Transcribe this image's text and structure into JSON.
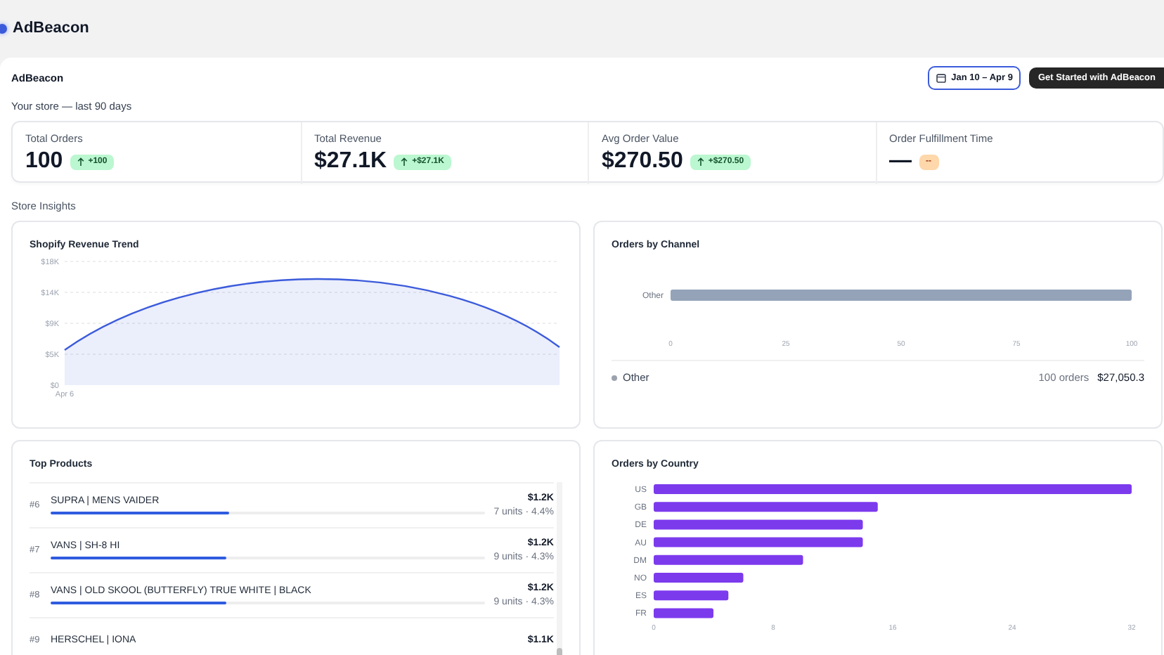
{
  "header": {
    "title": "AdBeacon"
  },
  "page": {
    "title": "AdBeacon",
    "subtitle": "Your store — last 90 days",
    "date_range": "Jan 10 – Apr 9",
    "cta": "Get Started with AdBeacon"
  },
  "kpis": [
    {
      "label": "Total Orders",
      "value": "100",
      "delta": "+100",
      "kind": "up"
    },
    {
      "label": "Total Revenue",
      "value": "$27.1K",
      "delta": "+$27.1K",
      "kind": "up"
    },
    {
      "label": "Avg Order Value",
      "value": "$270.50",
      "delta": "+$270.50",
      "kind": "up"
    },
    {
      "label": "Order Fulfillment Time",
      "value": "—",
      "delta": "--",
      "kind": "flat"
    }
  ],
  "section_title": "Store Insights",
  "revenue_trend": {
    "title": "Shopify Revenue Trend",
    "y_labels": [
      "$18K",
      "$14K",
      "$9K",
      "$5K",
      "$0"
    ],
    "x_labels": [
      "Apr 6"
    ]
  },
  "channels": {
    "title": "Orders by Channel",
    "chart_data": {
      "type": "bar",
      "orientation": "horizontal",
      "categories": [
        "Other"
      ],
      "series": [
        {
          "color": "#94a3b8",
          "values": [
            100
          ]
        }
      ],
      "xlim": [
        0,
        100
      ],
      "xticks": [
        0,
        25,
        50,
        75,
        100
      ]
    },
    "legend": [
      {
        "name": "Other",
        "color": "#9ca3af",
        "orders": "100 orders",
        "revenue": "$27,050.3"
      }
    ]
  },
  "top_products": {
    "title": "Top Products",
    "items": [
      {
        "rank": "#6",
        "name": "SUPRA | MENS VAIDER",
        "level": 0.41,
        "revenue": "$1.2K",
        "detail": "7 units · 4.4%"
      },
      {
        "rank": "#7",
        "name": "VANS | SH-8 HI",
        "level": 0.405,
        "revenue": "$1.2K",
        "detail": "9 units · 4.3%"
      },
      {
        "rank": "#8",
        "name": "VANS | OLD SKOOL (BUTTERFLY) TRUE WHITE | BLACK",
        "level": 0.405,
        "revenue": "$1.2K",
        "detail": "9 units · 4.3%"
      },
      {
        "rank": "#9",
        "name": "HERSCHEL | IONA",
        "revenue": "$1.1K"
      }
    ]
  },
  "countries": {
    "title": "Orders by Country",
    "chart_data": {
      "type": "bar",
      "orientation": "horizontal",
      "categories": [
        "US",
        "GB",
        "DE",
        "AU",
        "DM",
        "NO",
        "ES",
        "FR"
      ],
      "series": [
        {
          "color": "#7c3aed",
          "values": [
            32,
            15,
            14,
            14,
            10,
            6,
            5,
            4
          ]
        }
      ],
      "xlim": [
        0,
        32
      ],
      "xticks": [
        0,
        8,
        16,
        24,
        32
      ]
    }
  }
}
